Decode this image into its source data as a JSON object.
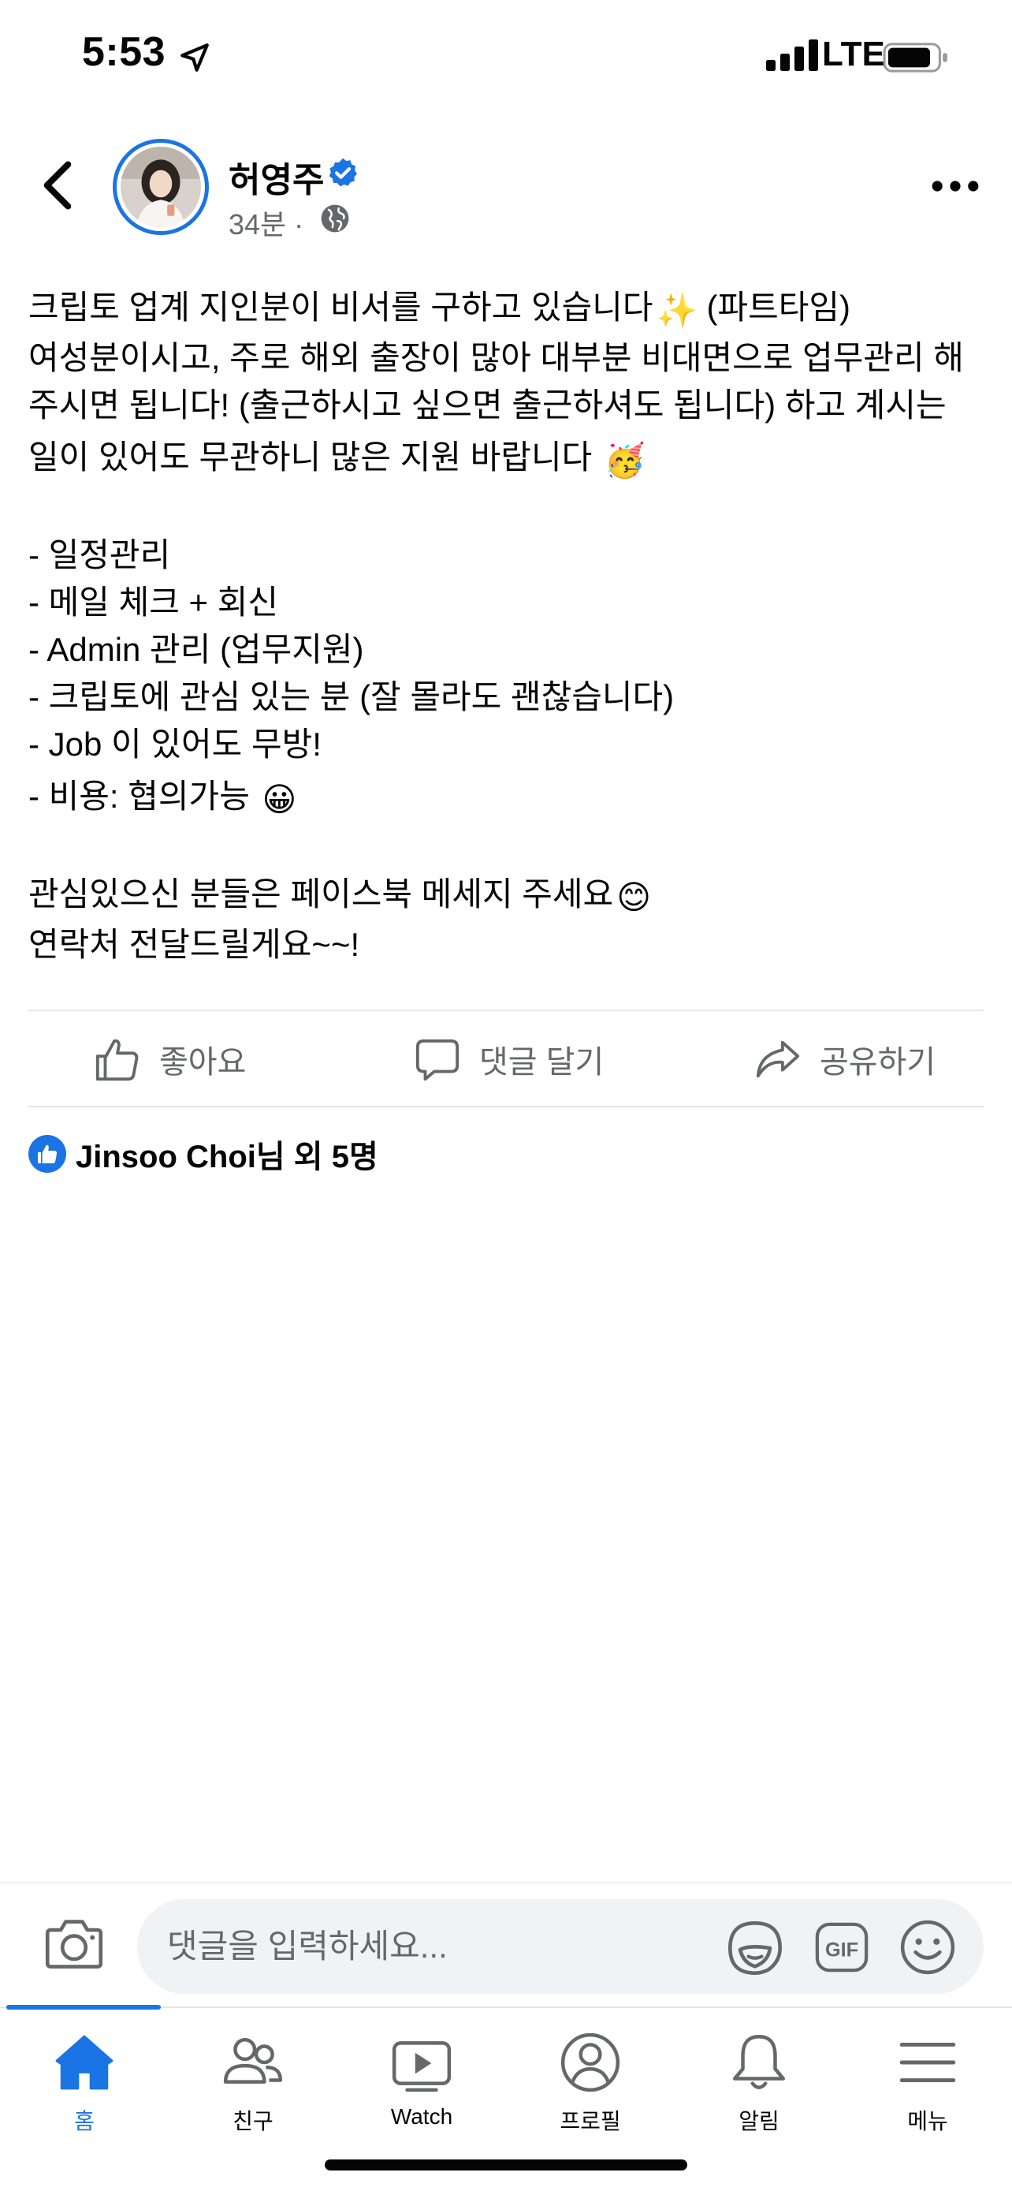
{
  "status_bar": {
    "time": "5:53",
    "network": "LTE",
    "icons": [
      "location-arrow-icon",
      "signal-icon",
      "battery-icon"
    ]
  },
  "post": {
    "author": "허영주",
    "time_ago": "34분 ·",
    "audience_icon": "globe-icon",
    "verified": true,
    "lines": [
      {
        "text": "크립토 업계 지인분이 비서를 구하고 있습니다",
        "emoji": "✨",
        "suffix": " (파트타임)"
      },
      {
        "text": "여성분이시고, 주로 해외 출장이 많아 대부분 비대면으로 업무관리 해"
      },
      {
        "text": "주시면 됩니다! (출근하시고 싶으면 출근하셔도 됩니다) 하고 계시는"
      },
      {
        "text": "일이 있어도 무관하니 많은 지원 바랍니다 ",
        "emoji": "🥳"
      },
      {
        "text": ""
      },
      {
        "text": "- 일정관리"
      },
      {
        "text": "- 메일 체크 + 회신"
      },
      {
        "text": "- Admin 관리 (업무지원)"
      },
      {
        "text": "- 크립토에 관심 있는 분 (잘 몰라도 괜찮습니다)"
      },
      {
        "text": "- Job 이 있어도 무방!"
      },
      {
        "text": "- 비용: 협의가능 ",
        "emoji": "😀"
      },
      {
        "text": ""
      },
      {
        "text": "관심있으신 분들은 페이스북 메세지 주세요",
        "emoji": "😊"
      },
      {
        "text": "연락처 전달드릴게요~~!"
      }
    ],
    "actions": {
      "like": "좋아요",
      "comment": "댓글 달기",
      "share": "공유하기"
    },
    "reactions_text": "Jinsoo Choi님 외 5명"
  },
  "comment_bar": {
    "placeholder": "댓글을 입력하세요..."
  },
  "bottom_nav": {
    "items": [
      {
        "label": "홈",
        "icon": "home-icon",
        "active": true
      },
      {
        "label": "친구",
        "icon": "friends-icon",
        "active": false
      },
      {
        "label": "Watch",
        "icon": "watch-icon",
        "active": false
      },
      {
        "label": "프로필",
        "icon": "profile-icon",
        "active": false
      },
      {
        "label": "알림",
        "icon": "bell-icon",
        "active": false
      },
      {
        "label": "메뉴",
        "icon": "menu-icon",
        "active": false
      }
    ]
  },
  "colors": {
    "accent": "#1b74e4",
    "secondary_text": "#65676b",
    "divider": "#e4e6eb",
    "input_bg": "#f0f2f5"
  }
}
